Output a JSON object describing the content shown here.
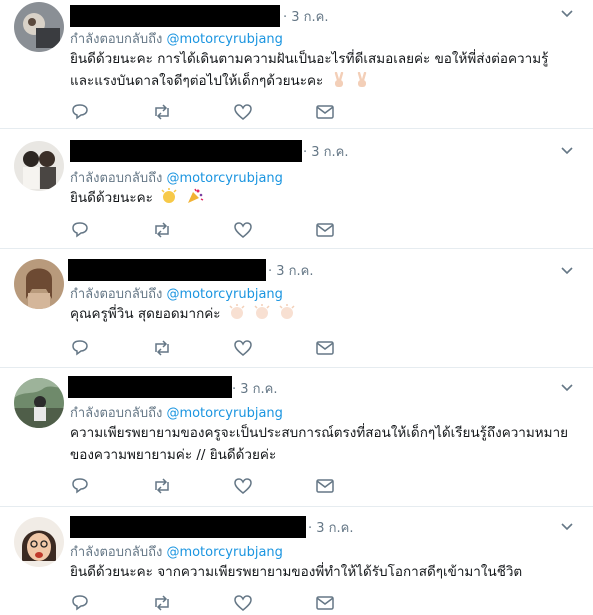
{
  "reply_prefix": "กำลังตอบกลับถึง",
  "mention": "@motorcyrubjang",
  "tweets": [
    {
      "date": "· 3 ก.ค.",
      "text": "ยินดีด้วยนะคะ การได้เดินตามความฝันเป็นอะไรที่ดีเสมอเลยค่ะ ขอให้พี่ส่งต่อความรู้และแรงบันดาลใจดีๆต่อไปให้เด็กๆด้วยนะคะ",
      "emojis": [
        "victory-hand-emoji",
        "victory-hand-emoji"
      ]
    },
    {
      "date": "· 3 ก.ค.",
      "text": "ยินดีด้วยนะคะ",
      "emojis": [
        "clapping-hands-emoji",
        "party-popper-emoji"
      ]
    },
    {
      "date": "· 3 ก.ค.",
      "text": "คุณครูพี่วิน สุดยอดมากค่ะ",
      "emojis": [
        "clapping-hands-emoji",
        "clapping-hands-emoji",
        "clapping-hands-emoji"
      ]
    },
    {
      "date": "· 3 ก.ค.",
      "text": "ความเพียรพยายามของครูจะเป็นประสบการณ์ตรงที่สอนให้เด็กๆได้เรียนรู้ถึงความหมายของความพยายามค่ะ // ยินดีด้วยค่ะ",
      "emojis": []
    },
    {
      "date": "· 3 ก.ค.",
      "text": "ยินดีด้วยนะคะ จากความเพียรพยายามของพี่ทำให้ได้รับโอกาสดีๆเข้ามาในชีวิต",
      "emojis": []
    }
  ],
  "colors": {
    "accent": "#1b95e0",
    "muted": "#657786",
    "text": "#14171a",
    "divider": "#e6ecf0"
  },
  "icons": [
    "reply-icon",
    "retweet-icon",
    "like-icon",
    "message-icon",
    "chevron-down-icon"
  ]
}
